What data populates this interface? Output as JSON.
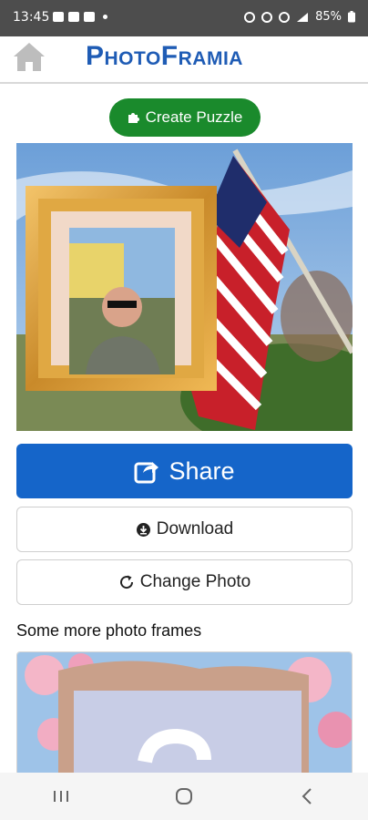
{
  "status_bar": {
    "time": "13:45",
    "battery": "85%"
  },
  "header": {
    "logo_text": "PhotoFramia"
  },
  "toolbar": {
    "create_puzzle_label": "Create Puzzle"
  },
  "actions": {
    "share_label": "Share",
    "download_label": "Download",
    "change_photo_label": "Change Photo"
  },
  "more_frames": {
    "title": "Some more photo frames"
  },
  "colors": {
    "brand_blue": "#1f5cb5",
    "share_blue": "#1565c9",
    "puzzle_green": "#1a8a2c"
  },
  "icons": [
    "home-icon",
    "puzzle-icon",
    "share-icon",
    "download-icon",
    "refresh-icon"
  ]
}
